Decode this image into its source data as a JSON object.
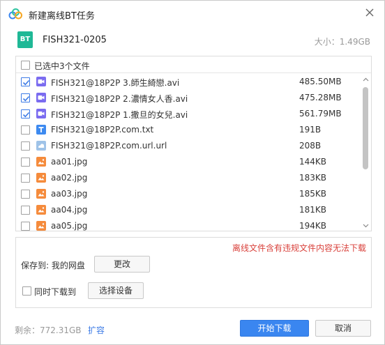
{
  "window": {
    "title": "新建离线BT任务",
    "logo_icon": "cloud-logo-icon",
    "close_icon": "close-icon"
  },
  "bt": {
    "badge": "BT",
    "name": "FISH321-0205",
    "size_label": "大小：1.49GB"
  },
  "list": {
    "header_label": "已选中3个文件",
    "files": [
      {
        "name": "FISH321@18P2P 3.師生綺戀.avi",
        "size": "485.50MB",
        "checked": true,
        "icon": "video-icon",
        "color": "#7b6cf0"
      },
      {
        "name": "FISH321@18P2P 2.濃情女人香.avi",
        "size": "475.28MB",
        "checked": true,
        "icon": "video-icon",
        "color": "#7b6cf0"
      },
      {
        "name": "FISH321@18P2P 1.撒旦的女兒.avi",
        "size": "561.79MB",
        "checked": true,
        "icon": "video-icon",
        "color": "#7b6cf0"
      },
      {
        "name": "FISH321@18P2P.com.txt",
        "size": "191B",
        "checked": false,
        "icon": "text-file-icon",
        "color": "#3d8af0"
      },
      {
        "name": "FISH321@18P2P.com.url.url",
        "size": "208B",
        "checked": false,
        "icon": "link-file-icon",
        "color": "#9fc3e8"
      },
      {
        "name": "aa01.jpg",
        "size": "144KB",
        "checked": false,
        "icon": "image-icon",
        "color": "#f58b3c"
      },
      {
        "name": "aa02.jpg",
        "size": "183KB",
        "checked": false,
        "icon": "image-icon",
        "color": "#f58b3c"
      },
      {
        "name": "aa03.jpg",
        "size": "185KB",
        "checked": false,
        "icon": "image-icon",
        "color": "#f58b3c"
      },
      {
        "name": "aa04.jpg",
        "size": "181KB",
        "checked": false,
        "icon": "image-icon",
        "color": "#f58b3c"
      },
      {
        "name": "aa05.jpg",
        "size": "194KB",
        "checked": false,
        "icon": "image-icon",
        "color": "#f58b3c"
      }
    ]
  },
  "save": {
    "warning": "离线文件含有违规文件内容无法下载",
    "location_label": "保存到: 我的网盘",
    "change_button": "更改",
    "sync_label": "同时下载到",
    "device_button": "选择设备"
  },
  "footer": {
    "remaining": "剩余：772.31GB",
    "expand_link": "扩容",
    "start_button": "开始下载",
    "cancel_button": "取消"
  },
  "colors": {
    "accent": "#3a86f0",
    "warning": "#d9413b",
    "bt_badge": "#1fb896"
  }
}
